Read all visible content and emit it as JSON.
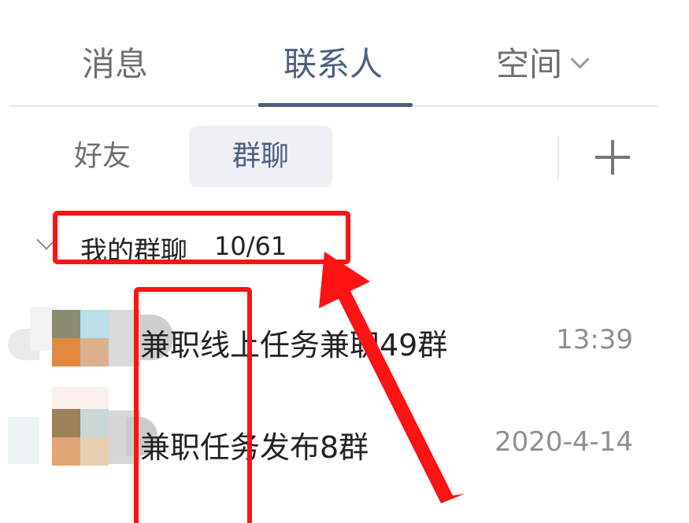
{
  "top_tabs": {
    "messages": "消息",
    "contacts": "联系人",
    "space": "空间"
  },
  "sub_tabs": {
    "friends": "好友",
    "groups": "群聊"
  },
  "group_section": {
    "title": "我的群聊",
    "count": "10/61"
  },
  "groups": [
    {
      "name": "兼职线上任务兼职49群",
      "time": "13:39"
    },
    {
      "name": "兼职任务发布8群",
      "time": "2020-4-14"
    }
  ],
  "colors": {
    "accent": "#4f5e80",
    "annotation": "#ff1212"
  },
  "icons": {
    "space_dropdown": "chevron-down-icon",
    "add": "plus-icon",
    "collapse": "chevron-down-icon"
  }
}
